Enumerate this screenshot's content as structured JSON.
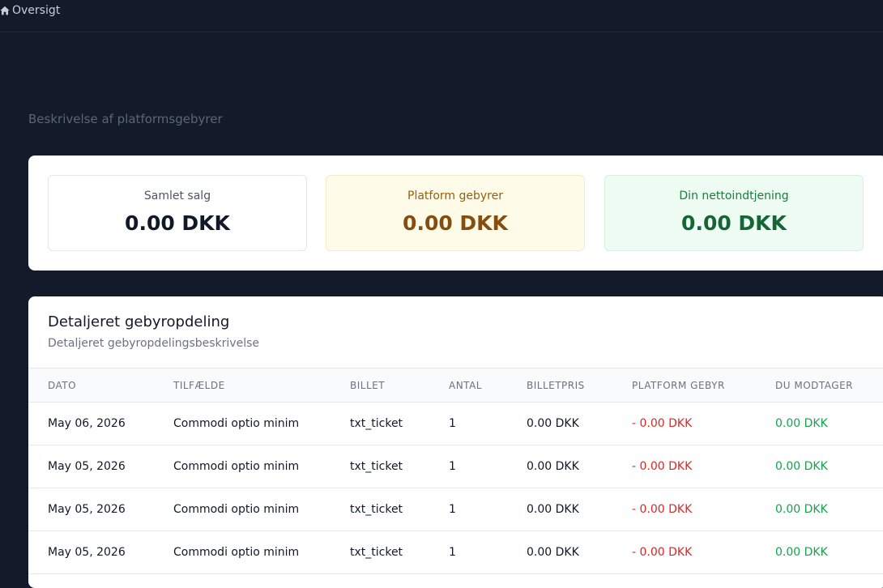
{
  "nav": {
    "breadcrumb_label": "Oversigt",
    "home_icon": "home-icon"
  },
  "page": {
    "subtitle": "Beskrivelse af platformsgebyrer"
  },
  "summary": {
    "total_sales": {
      "label": "Samlet salg",
      "value": "0.00 DKK"
    },
    "platform_fees": {
      "label": "Platform gebyrer",
      "value": "0.00 DKK"
    },
    "net_earnings": {
      "label": "Din nettoindtjening",
      "value": "0.00 DKK"
    }
  },
  "details": {
    "title": "Detaljeret gebyropdeling",
    "description": "Detaljeret gebyropdelingsbeskrivelse",
    "columns": [
      "DATO",
      "TILFÆLDE",
      "BILLET",
      "ANTAL",
      "BILLETPRIS",
      "PLATFORM GEBYR",
      "DU MODTAGER"
    ],
    "rows": [
      {
        "date": "May 06, 2026",
        "case": "Commodi optio minim",
        "ticket": "txt_ticket",
        "qty": "1",
        "price": "0.00 DKK",
        "fee": "- 0.00 DKK",
        "receive": "0.00 DKK"
      },
      {
        "date": "May 05, 2026",
        "case": "Commodi optio minim",
        "ticket": "txt_ticket",
        "qty": "1",
        "price": "0.00 DKK",
        "fee": "- 0.00 DKK",
        "receive": "0.00 DKK"
      },
      {
        "date": "May 05, 2026",
        "case": "Commodi optio minim",
        "ticket": "txt_ticket",
        "qty": "1",
        "price": "0.00 DKK",
        "fee": "- 0.00 DKK",
        "receive": "0.00 DKK"
      },
      {
        "date": "May 05, 2026",
        "case": "Commodi optio minim",
        "ticket": "txt_ticket",
        "qty": "1",
        "price": "0.00 DKK",
        "fee": "- 0.00 DKK",
        "receive": "0.00 DKK"
      }
    ]
  },
  "colors": {
    "background": "#131a2a",
    "fee_negative": "#dc2626",
    "receive_positive": "#16a34a",
    "fees_card": "#fefbe8",
    "net_card": "#eefcf3"
  }
}
